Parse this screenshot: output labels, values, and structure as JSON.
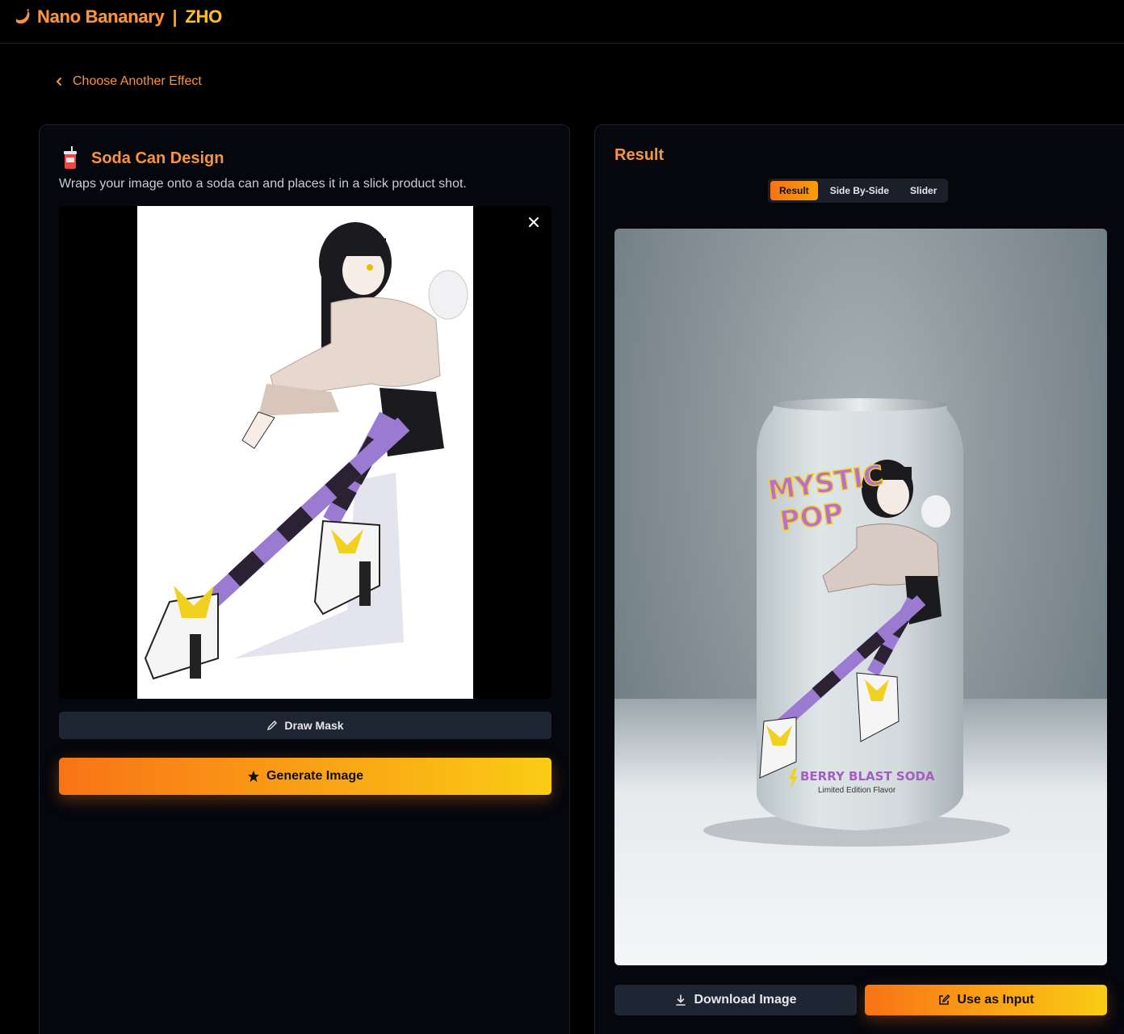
{
  "header": {
    "brand_name": "Nano Bananary",
    "separator": "|",
    "brand_suffix": "ZHO",
    "logo_icon": "banana-icon"
  },
  "nav": {
    "back_label": "Choose Another Effect",
    "back_icon": "chevron-left-icon"
  },
  "effect": {
    "icon": "soda-cup-icon",
    "title": "Soda Can Design",
    "description": "Wraps your image onto a soda can and places it in a slick product shot."
  },
  "input": {
    "image": "anime-girl-striped-stockings-illustration",
    "close_icon": "close-icon"
  },
  "buttons": {
    "draw_mask": "Draw Mask",
    "generate": "Generate Image",
    "download": "Download Image",
    "use_as_input": "Use as Input"
  },
  "result": {
    "title": "Result",
    "tabs": [
      {
        "label": "Result",
        "active": true
      },
      {
        "label": "Side By-Side",
        "active": false
      },
      {
        "label": "Slider",
        "active": false
      }
    ],
    "can_text": {
      "brand_line1": "MYSTIC",
      "brand_line2": "POP",
      "product": "BERRY BLAST SODA",
      "tagline": "Limited Edition Flavor"
    }
  },
  "colors": {
    "accent": "#fb923c",
    "accent_yellow": "#facc15",
    "panel_bg": "#05070d",
    "button_dark": "#1f2633"
  }
}
